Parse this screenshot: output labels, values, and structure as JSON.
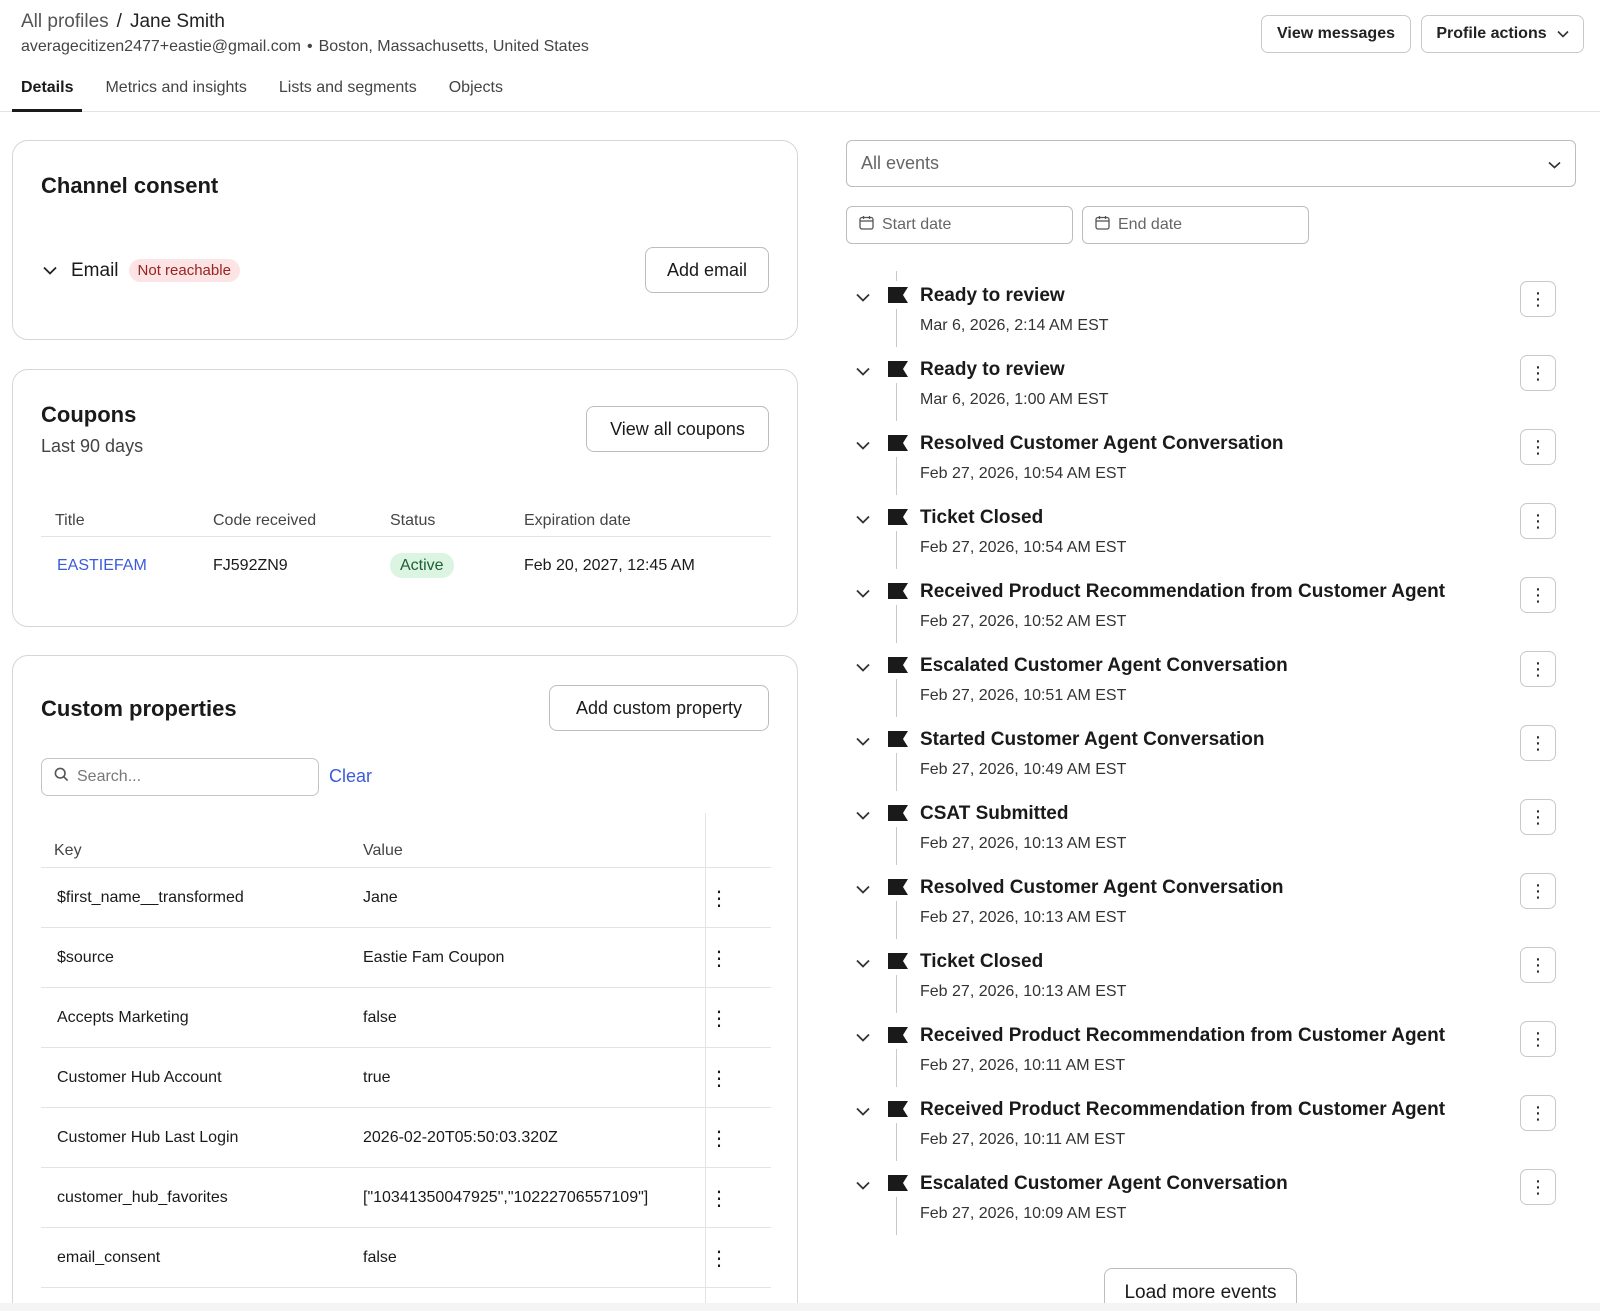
{
  "header": {
    "breadcrumb_root": "All profiles",
    "breadcrumb_sep": "/",
    "breadcrumb_current": "Jane Smith",
    "email": "averagecitizen2477+eastie@gmail.com",
    "location": "Boston, Massachusetts, United States",
    "view_messages": "View messages",
    "profile_actions": "Profile actions"
  },
  "tabs": [
    "Details",
    "Metrics and insights",
    "Lists and segments",
    "Objects"
  ],
  "consent": {
    "title": "Channel consent",
    "email_label": "Email",
    "email_status": "Not reachable",
    "add_email": "Add email"
  },
  "coupons": {
    "title": "Coupons",
    "subtitle": "Last 90 days",
    "view_all": "View all coupons",
    "columns": [
      "Title",
      "Code received",
      "Status",
      "Expiration date"
    ],
    "rows": [
      {
        "title": "EASTIEFAM",
        "code": "FJ592ZN9",
        "status": "Active",
        "expiration": "Feb 20, 2027, 12:45 AM"
      }
    ]
  },
  "custom": {
    "title": "Custom properties",
    "add_button": "Add custom property",
    "search_placeholder": "Search...",
    "clear": "Clear",
    "columns": [
      "Key",
      "Value"
    ],
    "rows": [
      {
        "key": "$first_name__transformed",
        "value": "Jane"
      },
      {
        "key": "$source",
        "value": "Eastie Fam Coupon"
      },
      {
        "key": "Accepts Marketing",
        "value": "false"
      },
      {
        "key": "Customer Hub Account",
        "value": "true"
      },
      {
        "key": "Customer Hub Last Login",
        "value": "2026-02-20T05:50:03.320Z"
      },
      {
        "key": "customer_hub_favorites",
        "value": "[\"10341350047925\",\"10222706557109\"]"
      },
      {
        "key": "email_consent",
        "value": "false"
      }
    ]
  },
  "events": {
    "filter": "All events",
    "start_placeholder": "Start date",
    "end_placeholder": "End date",
    "load_more": "Load more events",
    "items": [
      {
        "title": "Ready to review",
        "time": "Mar 6, 2026, 2:14 AM EST"
      },
      {
        "title": "Ready to review",
        "time": "Mar 6, 2026, 1:00 AM EST"
      },
      {
        "title": "Resolved Customer Agent Conversation",
        "time": "Feb 27, 2026, 10:54 AM EST"
      },
      {
        "title": "Ticket Closed",
        "time": "Feb 27, 2026, 10:54 AM EST"
      },
      {
        "title": "Received Product Recommendation from Customer Agent",
        "time": "Feb 27, 2026, 10:52 AM EST"
      },
      {
        "title": "Escalated Customer Agent Conversation",
        "time": "Feb 27, 2026, 10:51 AM EST"
      },
      {
        "title": "Started Customer Agent Conversation",
        "time": "Feb 27, 2026, 10:49 AM EST"
      },
      {
        "title": "CSAT Submitted",
        "time": "Feb 27, 2026, 10:13 AM EST"
      },
      {
        "title": "Resolved Customer Agent Conversation",
        "time": "Feb 27, 2026, 10:13 AM EST"
      },
      {
        "title": "Ticket Closed",
        "time": "Feb 27, 2026, 10:13 AM EST"
      },
      {
        "title": "Received Product Recommendation from Customer Agent",
        "time": "Feb 27, 2026, 10:11 AM EST"
      },
      {
        "title": "Received Product Recommendation from Customer Agent",
        "time": "Feb 27, 2026, 10:11 AM EST"
      },
      {
        "title": "Escalated Customer Agent Conversation",
        "time": "Feb 27, 2026, 10:09 AM EST"
      }
    ]
  },
  "colors": {
    "link": "#3b5bdb",
    "danger_bg": "#fbe4e3",
    "success_bg": "#dcf5e3"
  }
}
